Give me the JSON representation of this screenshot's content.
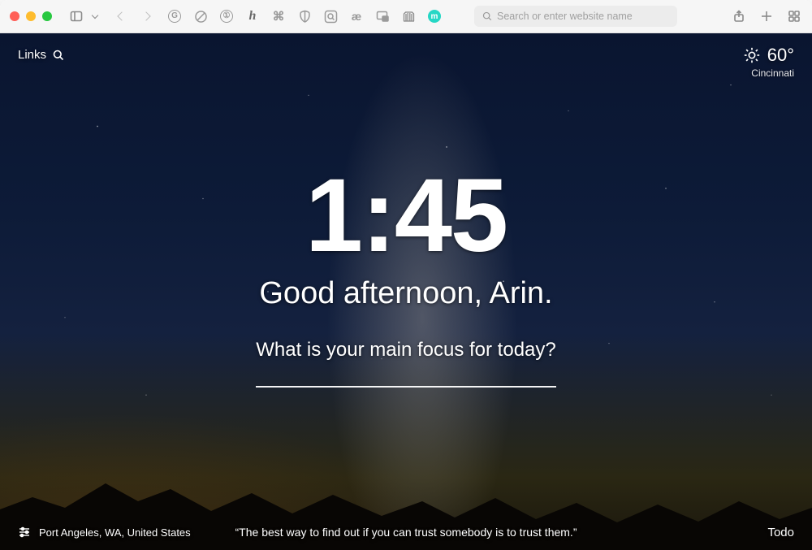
{
  "chrome": {
    "address_placeholder": "Search or enter website name",
    "extensions": [
      "C",
      "⊘",
      "①",
      "h",
      "⌘",
      "◧",
      "Q",
      "æ",
      "▣",
      "🏛",
      "m"
    ]
  },
  "dash": {
    "links_label": "Links",
    "weather": {
      "temp": "60°",
      "city": "Cincinnati"
    },
    "clock": "1:45",
    "greeting": "Good afternoon, Arin.",
    "focus_prompt": "What is your main focus for today?",
    "location": "Port Angeles, WA, United States",
    "quote": "“The best way to find out if you can trust somebody is to trust them.”",
    "todo_label": "Todo"
  }
}
